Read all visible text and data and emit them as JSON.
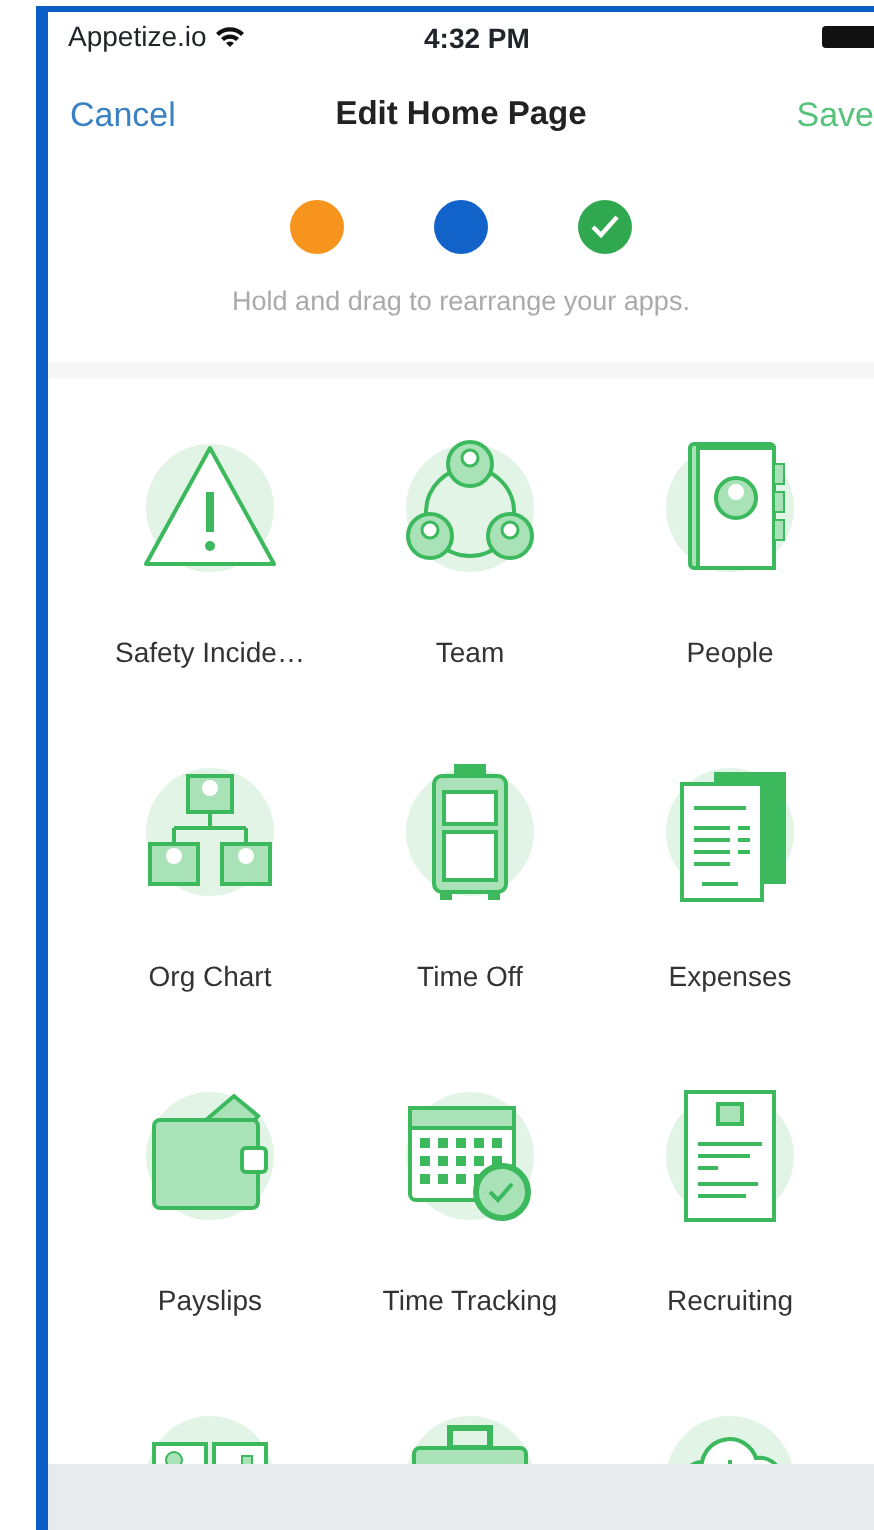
{
  "status_bar": {
    "carrier": "Appetize.io",
    "time": "4:32 PM"
  },
  "nav": {
    "cancel": "Cancel",
    "title": "Edit Home Page",
    "save": "Save"
  },
  "steps": [
    {
      "color": "#f7941d",
      "checked": false
    },
    {
      "color": "#1162c9",
      "checked": false
    },
    {
      "color": "#2fa84f",
      "checked": true
    }
  ],
  "hint": "Hold and drag to rearrange your apps.",
  "apps": [
    {
      "kind": "warning",
      "label": "Safety Incide…"
    },
    {
      "kind": "team",
      "label": "Team"
    },
    {
      "kind": "people",
      "label": "People"
    },
    {
      "kind": "org",
      "label": "Org Chart"
    },
    {
      "kind": "suitcase",
      "label": "Time Off"
    },
    {
      "kind": "receipt",
      "label": "Expenses"
    },
    {
      "kind": "wallet",
      "label": "Payslips"
    },
    {
      "kind": "calendar",
      "label": "Time Tracking"
    },
    {
      "kind": "resume",
      "label": "Recruiting"
    },
    {
      "kind": "dashboard"
    },
    {
      "kind": "briefcase"
    },
    {
      "kind": "cloud"
    }
  ]
}
